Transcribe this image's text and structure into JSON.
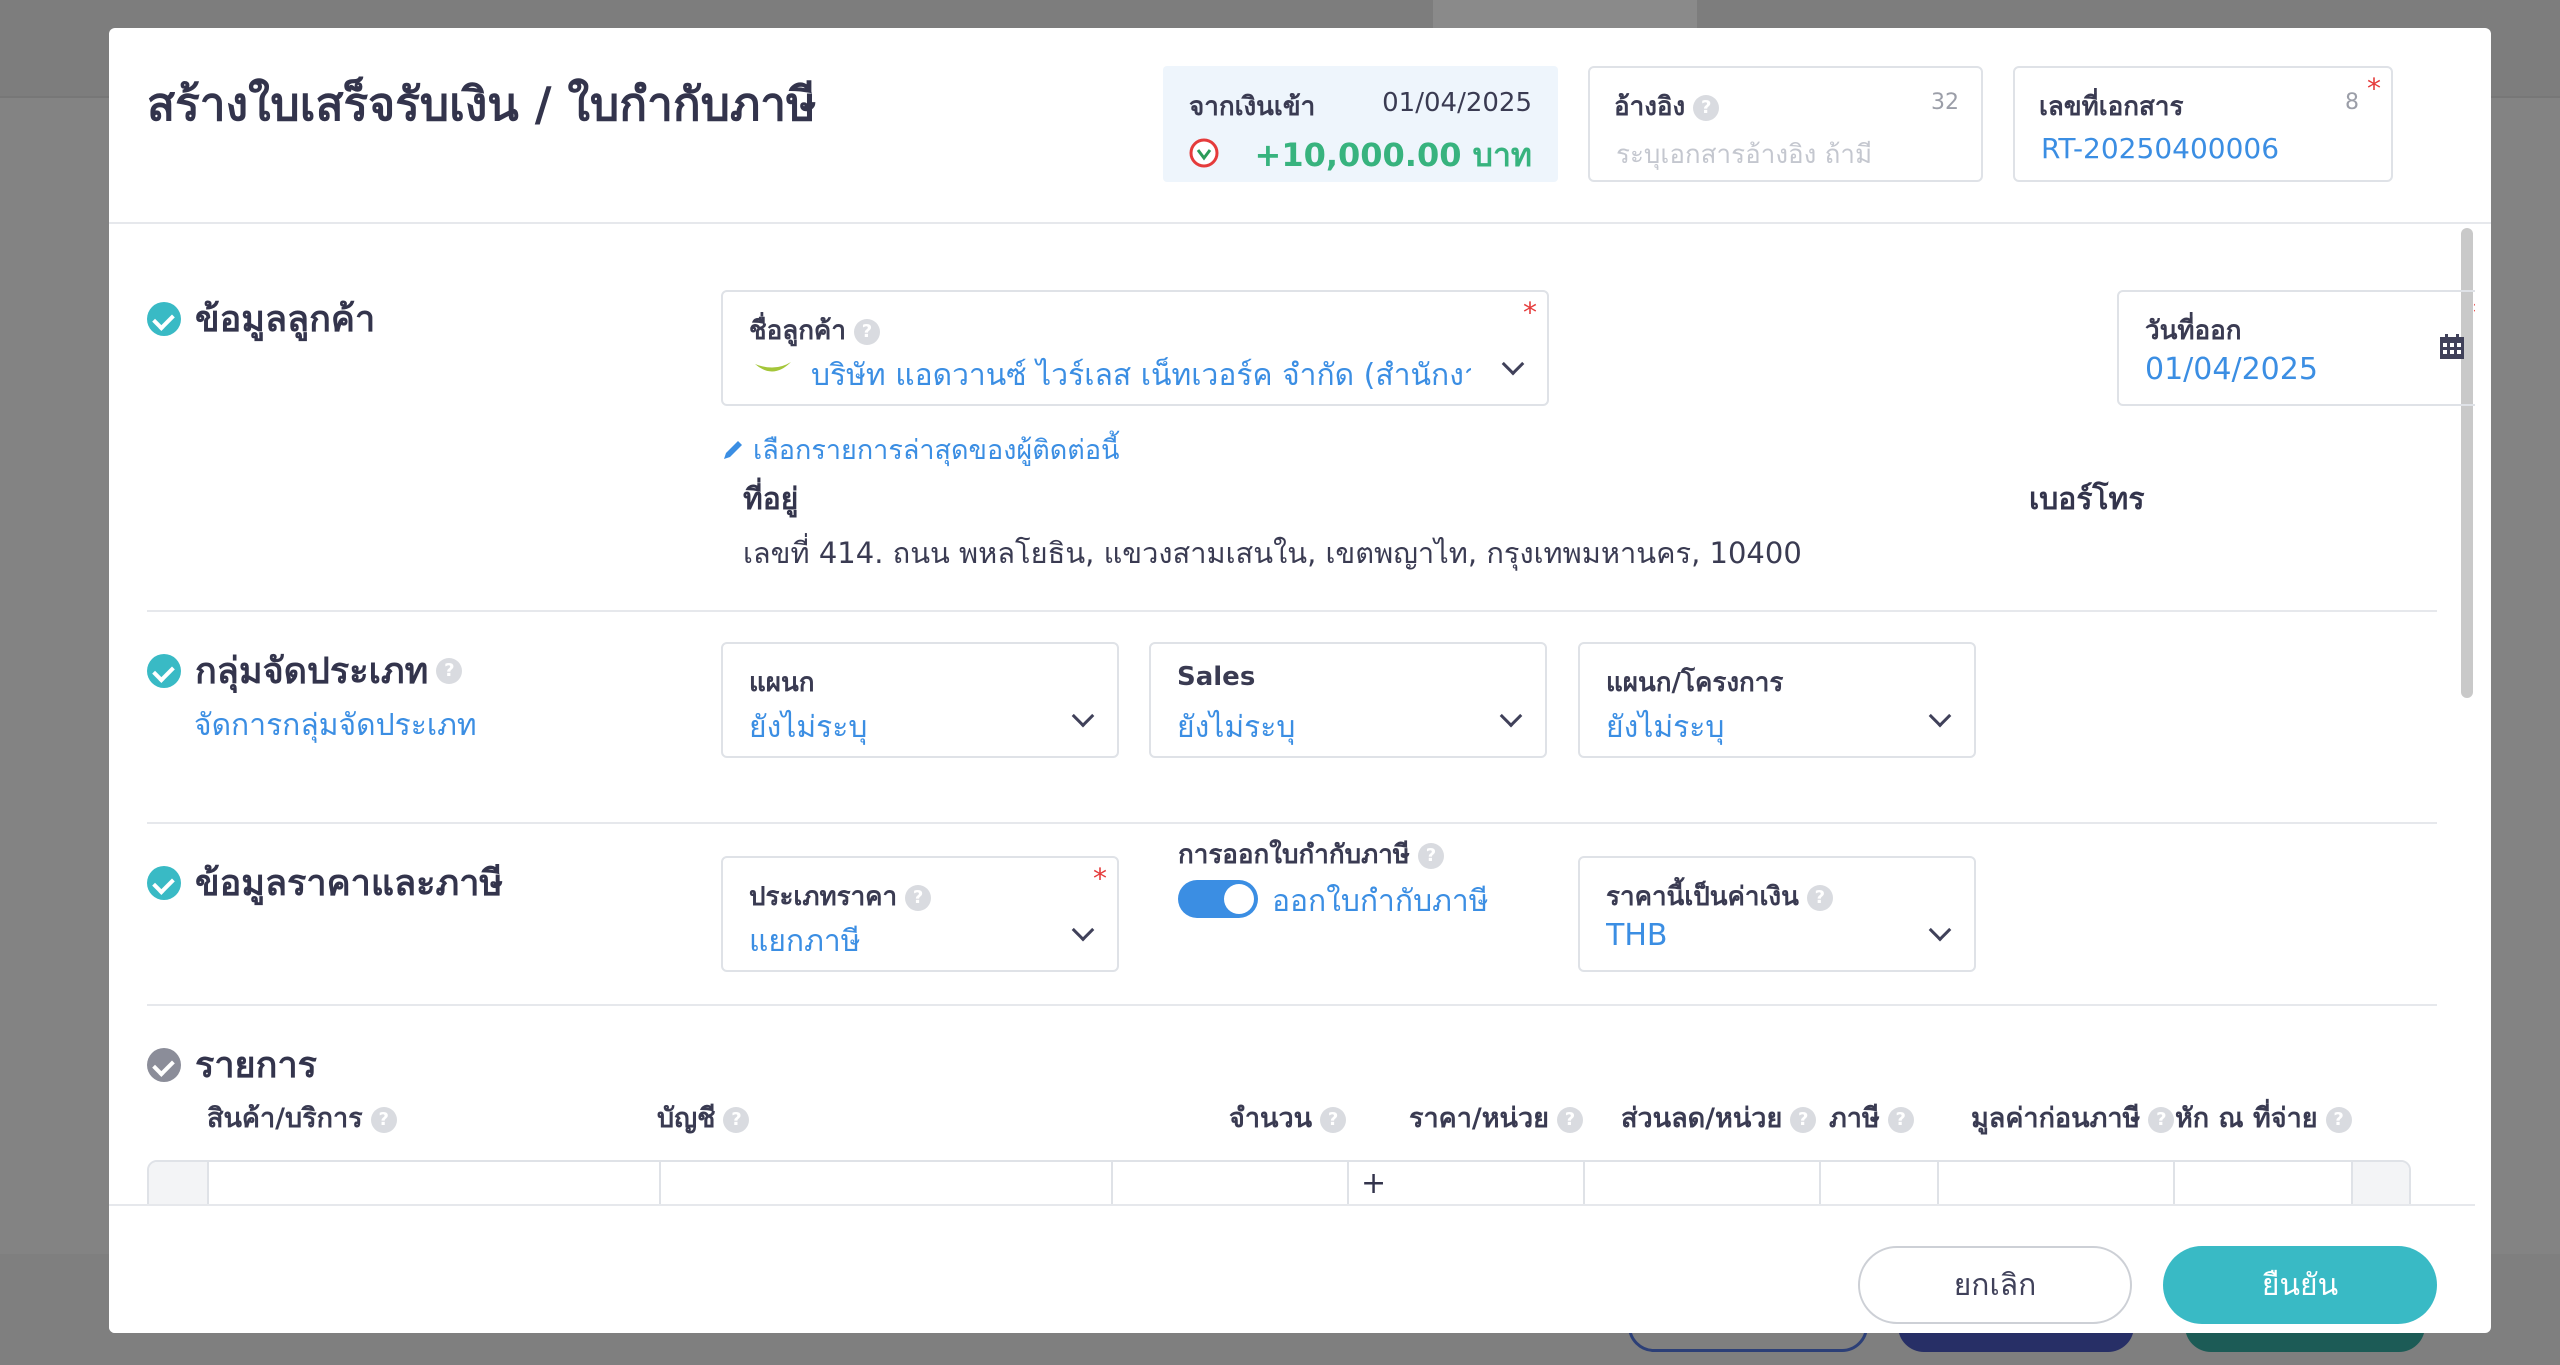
{
  "modal": {
    "title": "สร้างใบเสร็จรับเงิน / ใบกำกับภาษี"
  },
  "income": {
    "label": "จากเงินเข้า",
    "date": "01/04/2025",
    "amount": "+10,000.00 บาท",
    "icon": "bank-logo-icon"
  },
  "reference": {
    "label": "อ้างอิง",
    "count": "32",
    "placeholder": "ระบุเอกสารอ้างอิง ถ้ามี"
  },
  "doc_number": {
    "label": "เลขที่เอกสาร",
    "count": "8",
    "value": "RT-20250400006",
    "required_mark": "*"
  },
  "customer": {
    "section_title": "ข้อมูลลูกค้า",
    "name_label": "ชื่อลูกค้า",
    "name_value": "บริษัท แอดวานซ์ ไวร์เลส เน็ทเวอร์ค จำกัด (สำนักงาน...",
    "issue_date_label": "วันที่ออก",
    "issue_date_value": "01/04/2025",
    "recent_link": "เลือกรายการล่าสุดของผู้ติดต่อนี้",
    "address_label": "ที่อยู่",
    "address_value": "เลขที่ 414. ถนน พหลโยธิน, แขวงสามเสนใน, เขตพญาไท, กรุงเทพมหานคร, 10400",
    "phone_label": "เบอร์โทร"
  },
  "classification": {
    "section_title": "กลุ่มจัดประเภท",
    "manage_link": "จัดการกลุ่มจัดประเภท",
    "department_label": "แผนก",
    "department_value": "ยังไม่ระบุ",
    "sales_label": "Sales",
    "sales_value": "ยังไม่ระบุ",
    "project_label": "แผนก/โครงการ",
    "project_value": "ยังไม่ระบุ"
  },
  "pricing": {
    "section_title": "ข้อมูลราคาและภาษี",
    "price_type_label": "ประเภทราคา",
    "price_type_value": "แยกภาษี",
    "tax_invoice_label": "การออกใบกำกับภาษี",
    "tax_invoice_toggle": "ออกใบกำกับภาษี",
    "currency_label": "ราคานี้เป็นค่าเงิน",
    "currency_value": "THB"
  },
  "items": {
    "section_title": "รายการ",
    "columns": {
      "product": "สินค้า/บริการ",
      "account": "บัญชี",
      "quantity": "จำนวน",
      "unit_price": "ราคา/หน่วย",
      "discount": "ส่วนลด/หน่วย",
      "tax": "ภาษี",
      "pre_tax": "มูลค่าก่อนภาษี",
      "withholding": "หัก ณ ที่จ่าย"
    },
    "plus": "+"
  },
  "footer": {
    "cancel": "ยกเลิก",
    "confirm": "ยืนยัน"
  },
  "colors": {
    "accent": "#39bac5",
    "link": "#3b8ee3",
    "amount": "#37b37e",
    "required": "#e53b3b"
  }
}
